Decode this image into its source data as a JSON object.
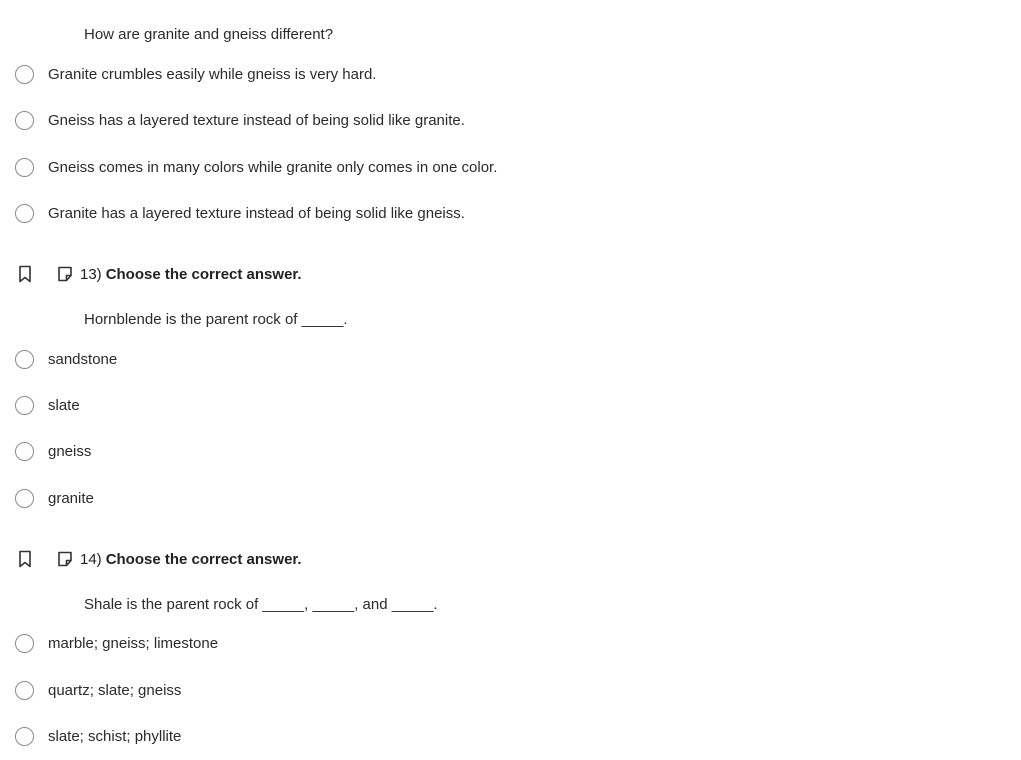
{
  "question12": {
    "stem": "How are granite and gneiss different?",
    "options": [
      "Granite crumbles easily while gneiss is very hard.",
      "Gneiss has a layered texture instead of being solid like granite.",
      "Gneiss comes in many colors while granite only comes in one color.",
      "Granite has a layered texture instead of being solid like gneiss."
    ]
  },
  "question13": {
    "number": "13)",
    "prompt": "Choose the correct answer.",
    "stem": "Hornblende is the parent rock of _____.",
    "options": [
      "sandstone",
      "slate",
      "gneiss",
      "granite"
    ]
  },
  "question14": {
    "number": "14)",
    "prompt": "Choose the correct answer.",
    "stem": "Shale is the parent rock of _____, _____, and _____.",
    "options": [
      "marble; gneiss; limestone",
      "quartz; slate; gneiss",
      "slate; schist; phyllite"
    ]
  },
  "icons": {
    "bookmark": "bookmark-icon",
    "note": "note-icon",
    "radio": "radio-unselected-icon"
  },
  "colors": {
    "text": "#222222",
    "radio_border": "#8a8a8a"
  }
}
